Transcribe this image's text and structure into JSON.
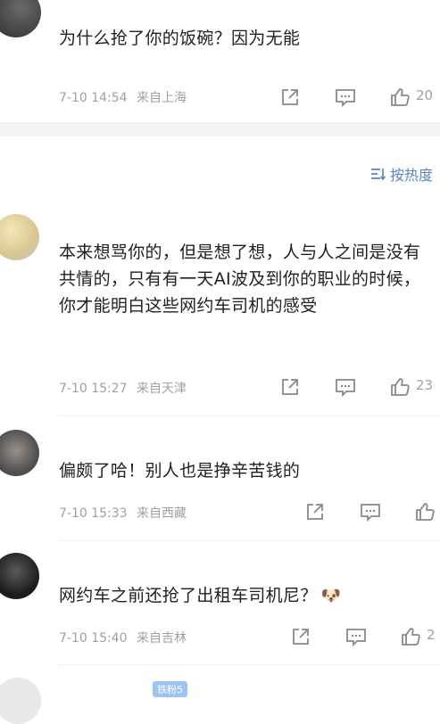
{
  "sort": {
    "label": "按热度"
  },
  "comments": [
    {
      "text": "为什么抢了你的饭碗？因为无能",
      "time": "7-10 14:54",
      "location": "来自上海",
      "likes": "20"
    },
    {
      "text": "本来想骂你的，但是想了想，人与人之间是没有共情的，只有有一天AI波及到你的职业的时候，你才能明白这些网约车司机的感受",
      "time": "7-10 15:27",
      "location": "来自天津",
      "likes": "23"
    },
    {
      "text": "偏颇了哈！别人也是挣辛苦钱的",
      "time": "7-10 15:33",
      "location": "来自西藏",
      "likes": ""
    },
    {
      "text": "网约车之前还抢了出租车司机尼？",
      "emoji": "🐶",
      "time": "7-10 15:40",
      "location": "来自吉林",
      "likes": "2"
    }
  ],
  "badge": {
    "label": "铁粉5"
  },
  "colors": {
    "accent": "#5a84c7",
    "meta": "#a0a0a0",
    "band": "#f3f3f3"
  },
  "icons": [
    "share-icon",
    "reply-icon",
    "like-icon",
    "sort-icon"
  ]
}
